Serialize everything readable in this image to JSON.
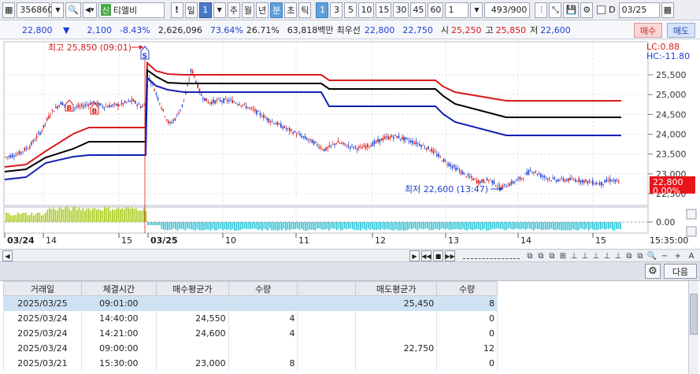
{
  "toolbar": {
    "code": "356860",
    "tag": "신",
    "name": "티엘비",
    "alert": "!",
    "periods": [
      "일",
      "1",
      "주",
      "월",
      "년",
      "분",
      "초",
      "틱",
      "1",
      "3",
      "5",
      "10",
      "15",
      "30",
      "45",
      "60",
      "1"
    ],
    "count": "493/900",
    "checkbox_d": "D",
    "date": "03/25"
  },
  "info": {
    "price": "22,800",
    "arrow": "▼",
    "change": "2,100",
    "rate": "-8.43%",
    "volume": "2,626,096",
    "vol_pct1": "73.64%",
    "vol_pct2": "26.71%",
    "amount": "63,818백만",
    "best_label": "최우선",
    "best_sell": "22,800",
    "best_buy": "22,750",
    "open_label": "시",
    "open": "25,250",
    "high_label": "고",
    "high": "25,850",
    "low_label": "저",
    "low": "22,600",
    "buy_btn": "매수",
    "sell_btn": "매도"
  },
  "chart": {
    "y_ticks": [
      "25,500",
      "25,000",
      "24,500",
      "24,000",
      "23,500",
      "23,000",
      "22,500"
    ],
    "lc": "LC:0.88",
    "hc": "HC:-11.80",
    "last_price": "22,800",
    "last_pct": "0.00%",
    "sub_tick": "0.00",
    "x_labels": [
      "03/24",
      "14",
      "15",
      "03/25",
      "10",
      "11",
      "12",
      "13",
      "14",
      "15"
    ],
    "time_label": "15:35:00",
    "high_annot": "최고 25,850 (09:01)",
    "low_annot": "최저 22,600 (13:47)",
    "marker_b": "B",
    "marker_s": "S",
    "colors": {
      "red_band": "#d81b1b",
      "black_band": "#000000",
      "blue_band": "#1420b4",
      "sub_up": "#aacc22",
      "sub_down": "#33c6d8"
    }
  },
  "lower": {
    "settings_icon": "gear-icon",
    "next_btn": "다음"
  },
  "table": {
    "headers": [
      "거래일",
      "체결시간",
      "매수평균가",
      "수량",
      "",
      "매도평균가",
      "수량"
    ],
    "rows": [
      [
        "2025/03/25",
        "09:01:00",
        "",
        "",
        "",
        "25,450",
        "8"
      ],
      [
        "2025/03/24",
        "14:40:00",
        "24,550",
        "4",
        "",
        "",
        "0"
      ],
      [
        "2025/03/24",
        "14:21:00",
        "24,600",
        "4",
        "",
        "",
        "0"
      ],
      [
        "2025/03/24",
        "09:00:00",
        "",
        "",
        "",
        "22,750",
        "12"
      ],
      [
        "2025/03/21",
        "15:30:00",
        "23,000",
        "8",
        "",
        "",
        "0"
      ]
    ]
  }
}
